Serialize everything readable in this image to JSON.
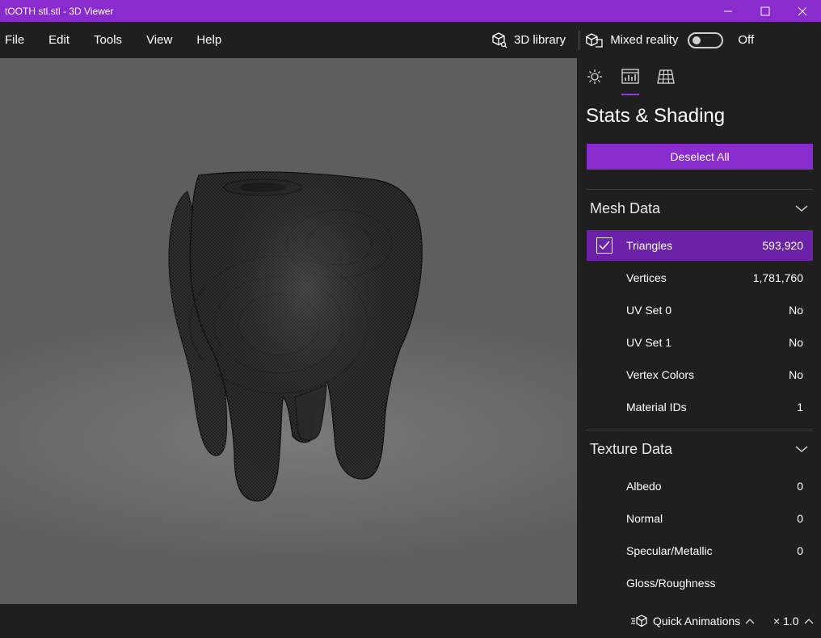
{
  "window": {
    "title": "tOOTH stl.stl - 3D Viewer",
    "minimize_glyph": "—",
    "maximize_glyph": "☐",
    "close_glyph": "✕"
  },
  "menu": {
    "items": [
      "File",
      "Edit",
      "Tools",
      "View",
      "Help"
    ],
    "library_label": "3D library",
    "mixed_reality_label": "Mixed reality",
    "mixed_reality_state": "Off"
  },
  "panel": {
    "tabs": [
      {
        "name": "lighting",
        "icon": "sun-icon"
      },
      {
        "name": "stats",
        "icon": "stats-icon",
        "active": true
      },
      {
        "name": "grid",
        "icon": "grid-icon"
      }
    ],
    "title": "Stats & Shading",
    "deselect_label": "Deselect All",
    "mesh_section": {
      "title": "Mesh Data",
      "rows": [
        {
          "label": "Triangles",
          "value": "593,920",
          "checked": true
        },
        {
          "label": "Vertices",
          "value": "1,781,760"
        },
        {
          "label": "UV Set 0",
          "value": "No"
        },
        {
          "label": "UV Set 1",
          "value": "No"
        },
        {
          "label": "Vertex Colors",
          "value": "No"
        },
        {
          "label": "Material IDs",
          "value": "1"
        }
      ]
    },
    "texture_section": {
      "title": "Texture Data",
      "rows": [
        {
          "label": "Albedo",
          "value": "0"
        },
        {
          "label": "Normal",
          "value": "0"
        },
        {
          "label": "Specular/Metallic",
          "value": "0"
        },
        {
          "label": "Gloss/Roughness",
          "value": ""
        }
      ]
    }
  },
  "bottombar": {
    "quick_animations_label": "Quick Animations",
    "speed_label": "× 1.0"
  },
  "colors": {
    "accent": "#8a2bce",
    "selected_row": "#6b21a8",
    "background": "#1f1f1f"
  }
}
